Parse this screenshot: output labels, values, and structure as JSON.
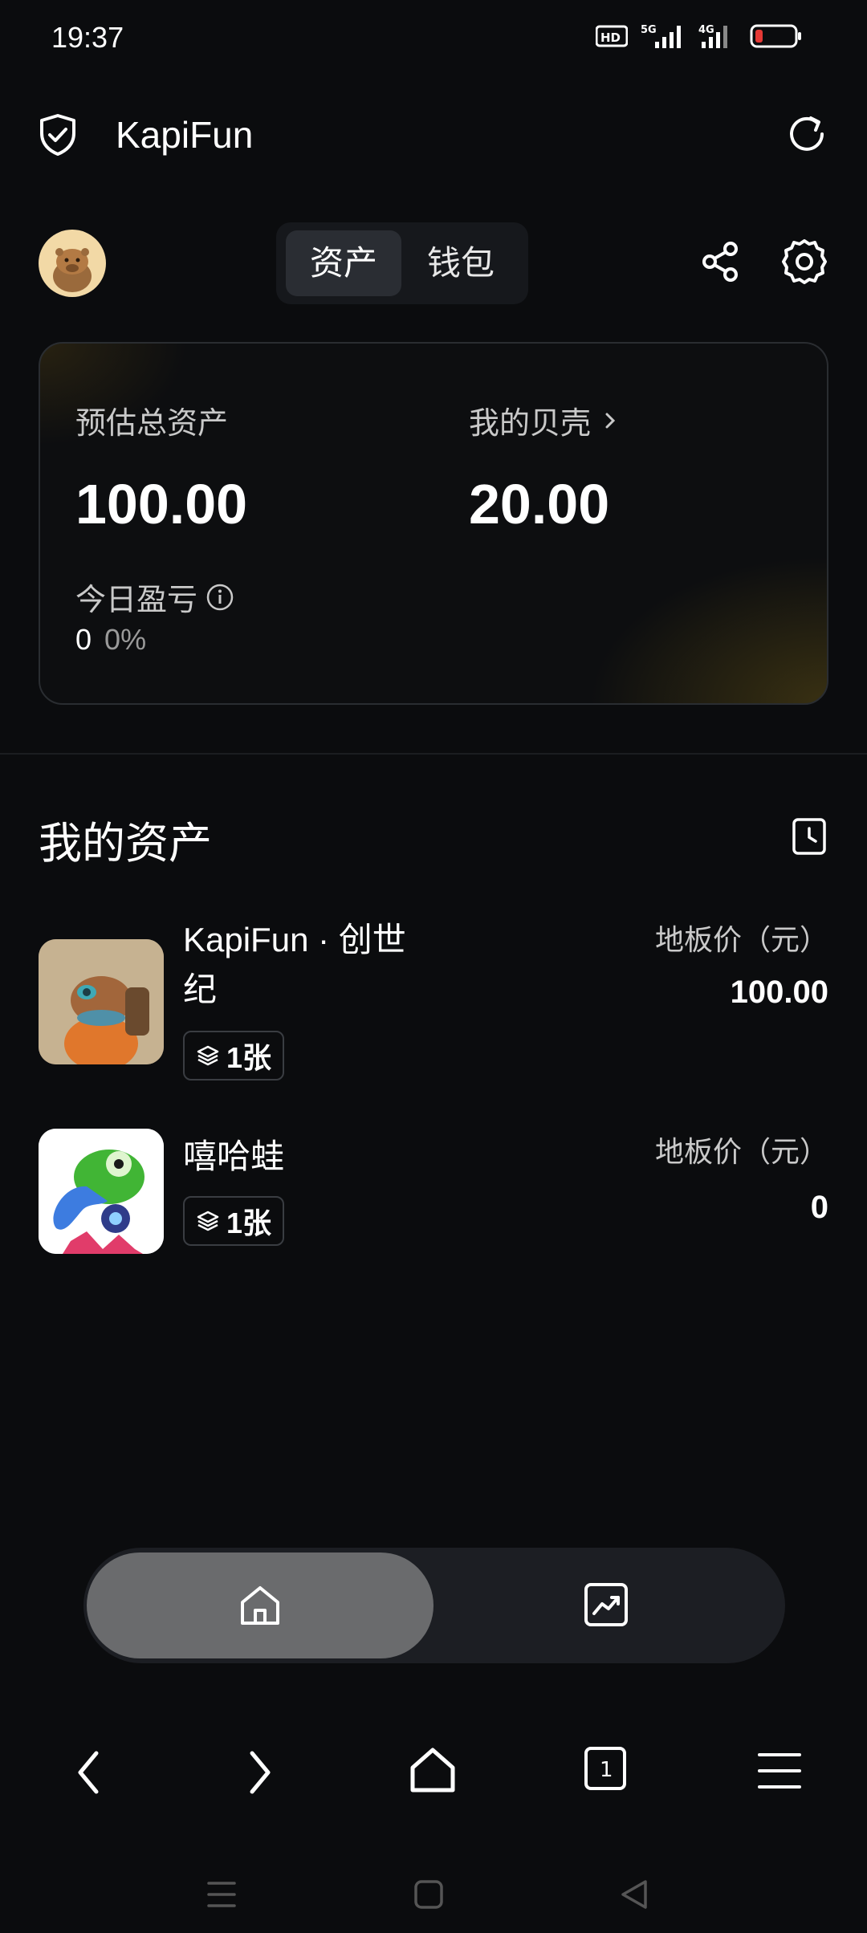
{
  "status_bar": {
    "time": "19:37",
    "icons": [
      "hd-voice-icon",
      "5g-signal-icon",
      "4g-signal-icon",
      "battery-low-icon"
    ]
  },
  "app": {
    "title": "KapiFun"
  },
  "tabs": {
    "assets_label": "资产",
    "wallet_label": "钱包",
    "active": "资产"
  },
  "card": {
    "estimated_total_label": "预估总资产",
    "estimated_total_value": "100.00",
    "shells_label": "我的贝壳",
    "shells_value": "20.00",
    "today_pnl_label": "今日盈亏",
    "today_pnl_value": "0",
    "today_pnl_percent": "0%"
  },
  "my_assets": {
    "title": "我的资产",
    "items": [
      {
        "name": "KapiFun · 创世纪",
        "count": "1张",
        "floor_label": "地板价（元）",
        "floor_value": "100.00"
      },
      {
        "name": "嘻哈蛙",
        "count": "1张",
        "floor_label": "地板价（元）",
        "floor_value": "0"
      }
    ]
  },
  "colors": {
    "background": "#0b0c0e",
    "card_border": "#2a2d31",
    "accent_gold": "#6e5a14",
    "battery_red": "#e53935"
  }
}
